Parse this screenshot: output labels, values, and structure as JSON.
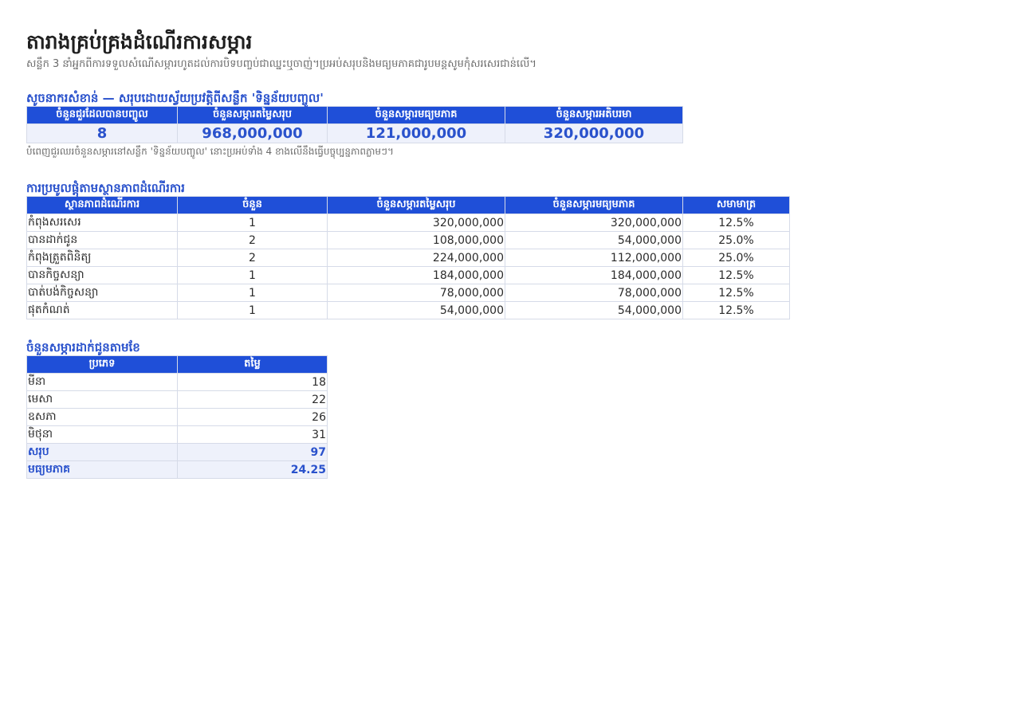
{
  "header": {
    "title": "តារាងគ្រប់គ្រងដំណើរការសម្ភារ",
    "subtitle": "សន្លឹក 3 នាំអ្នកពីការទទួលសំណើសម្ភារហូតដល់ការបិទបញ្ចប់ជាឈ្នះឬចាញ់។ប្រអប់សរុបនិងមធ្យមភាគជារូបមន្តសូមកុំសរសេរជាន់លើ។"
  },
  "summary": {
    "title": "សូចនាករសំខាន់ — សរុបដោយស្វ័យប្រវត្តិពីសន្លឹក 'ទិន្នន័យបញ្ចូល'",
    "headers": [
      "ចំនួនជួរដែលបានបញ្ចូល",
      "ចំនួនសម្ភារតម្លៃសរុប",
      "ចំនួនសម្ភារមធ្យមភាគ",
      "ចំនួនសម្ភារអតិបរមា"
    ],
    "values": [
      "8",
      "968,000,000",
      "121,000,000",
      "320,000,000"
    ],
    "note": "បំពេញជួរឈរចំនួនសម្ភារនៅសន្លឹក 'ទិន្នន័យបញ្ចូល' នោះប្រអប់ទាំង 4 ខាងលើនឹងធ្វើបច្ចុប្បន្នភាពភ្លាមៗ។"
  },
  "status_table": {
    "title": "ការប្រមូលផ្តុំតាមស្ថានភាពដំណើរការ",
    "headers": [
      "ស្ថានភាពដំណើរការ",
      "ចំនួន",
      "ចំនួនសម្ភារតម្លៃសរុប",
      "ចំនួនសម្ភារមធ្យមភាគ",
      "សមាមាត្រ"
    ],
    "rows": [
      [
        "កំពុងសរសេរ",
        "1",
        "320,000,000",
        "320,000,000",
        "12.5%"
      ],
      [
        "បានដាក់ជូន",
        "2",
        "108,000,000",
        "54,000,000",
        "25.0%"
      ],
      [
        "កំពុងត្រួតពិនិត្យ",
        "2",
        "224,000,000",
        "112,000,000",
        "25.0%"
      ],
      [
        "បានកិច្ចសន្យា",
        "1",
        "184,000,000",
        "184,000,000",
        "12.5%"
      ],
      [
        "បាត់បង់កិច្ចសន្យា",
        "1",
        "78,000,000",
        "78,000,000",
        "12.5%"
      ],
      [
        "ផុតកំណត់",
        "1",
        "54,000,000",
        "54,000,000",
        "12.5%"
      ]
    ]
  },
  "monthly_table": {
    "title": "ចំនួនសម្ភារដាក់ជូនតាមខែ",
    "headers": [
      "ប្រភេទ",
      "តម្លៃ"
    ],
    "rows": [
      [
        "មីនា",
        "18"
      ],
      [
        "មេសា",
        "22"
      ],
      [
        "ឧសភា",
        "26"
      ],
      [
        "មិថុនា",
        "31"
      ]
    ],
    "totals": [
      [
        "សរុប",
        "97"
      ],
      [
        "មធ្យមភាគ",
        "24.25"
      ]
    ]
  },
  "colors": {
    "header_bg": "#1f4fd8",
    "accent_text": "#2a52cc",
    "summary_bg": "#eef1fb"
  }
}
